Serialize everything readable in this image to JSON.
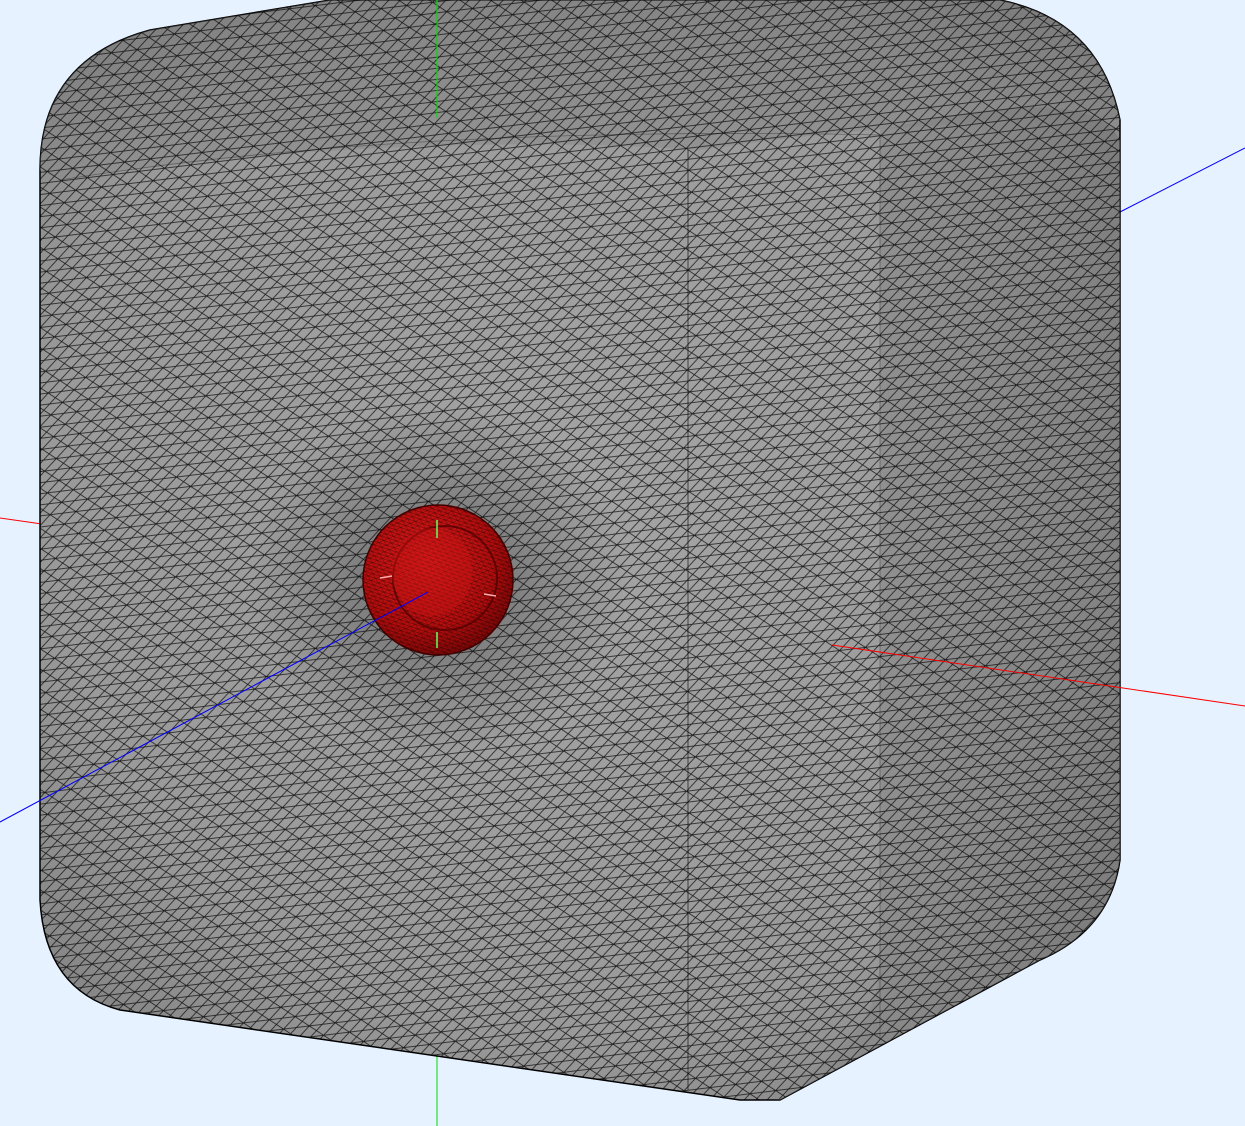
{
  "viewport": {
    "background": "#e6f2ff",
    "mesh": {
      "body_shape": "rounded cube",
      "surface_color": "#9b9b9b",
      "edge_color": "#000000",
      "inclusion_shape": "sphere",
      "inclusion_color": "#c01010"
    },
    "axes": {
      "x_color": "#ff0000",
      "y_color": "#00dd00",
      "z_color": "#0000ff"
    }
  }
}
